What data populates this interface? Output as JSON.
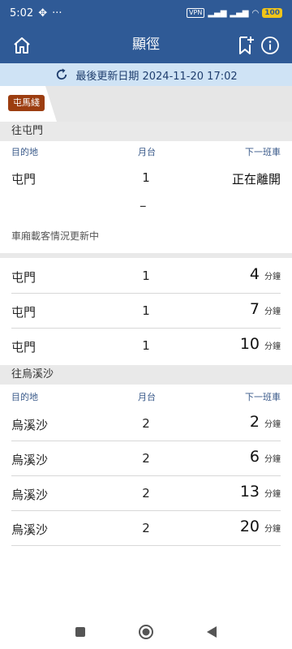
{
  "status_bar": {
    "time": "5:02",
    "vpn": "VPN",
    "battery": "100"
  },
  "header": {
    "title": "顯徑"
  },
  "update": {
    "text": "最後更新日期 2024-11-20 17:02"
  },
  "line_tab": {
    "label": "屯馬綫",
    "color": "#9c3d10"
  },
  "columns": {
    "destination": "目的地",
    "platform": "月台",
    "next_train": "下一班車"
  },
  "section_1": {
    "title": "往屯門",
    "first_row": {
      "destination": "屯門",
      "platform": "1",
      "status": "正在離開"
    },
    "placeholder": "–",
    "note": "車廂載客情況更新中",
    "rows": [
      {
        "destination": "屯門",
        "platform": "1",
        "minutes": "4",
        "unit": "分鐘"
      },
      {
        "destination": "屯門",
        "platform": "1",
        "minutes": "7",
        "unit": "分鐘"
      },
      {
        "destination": "屯門",
        "platform": "1",
        "minutes": "10",
        "unit": "分鐘"
      }
    ]
  },
  "section_2": {
    "title": "往烏溪沙",
    "rows": [
      {
        "destination": "烏溪沙",
        "platform": "2",
        "minutes": "2",
        "unit": "分鐘"
      },
      {
        "destination": "烏溪沙",
        "platform": "2",
        "minutes": "6",
        "unit": "分鐘"
      },
      {
        "destination": "烏溪沙",
        "platform": "2",
        "minutes": "13",
        "unit": "分鐘"
      },
      {
        "destination": "烏溪沙",
        "platform": "2",
        "minutes": "20",
        "unit": "分鐘"
      }
    ]
  },
  "icons": {
    "home": "home-icon",
    "bookmark": "bookmark-add-icon",
    "info": "info-icon",
    "refresh": "refresh-icon",
    "nav_recent": "square-icon",
    "nav_home": "circle-icon",
    "nav_back": "triangle-back-icon"
  }
}
